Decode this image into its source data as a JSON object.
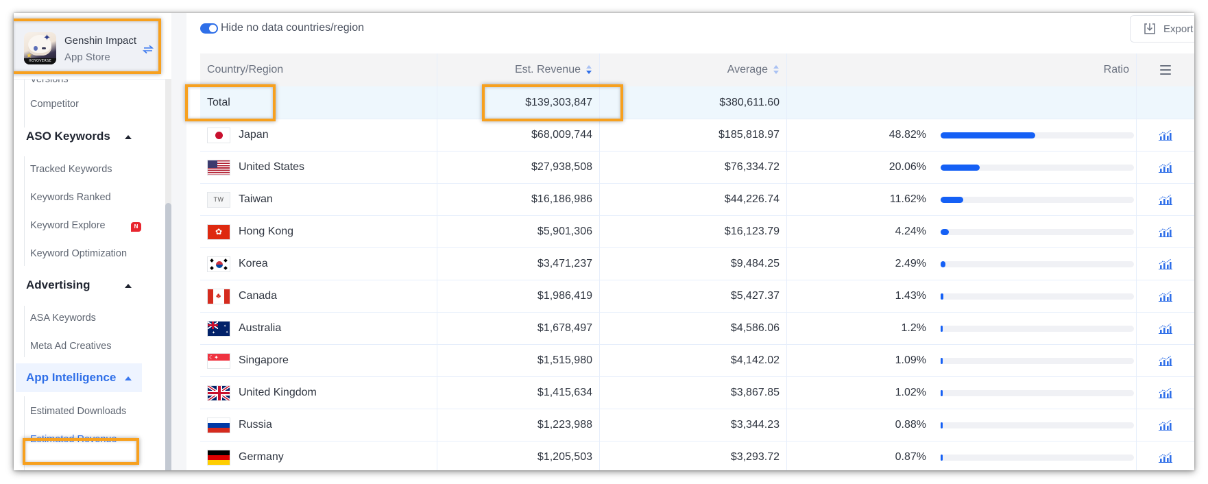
{
  "app": {
    "name": "Genshin Impact",
    "store": "App Store",
    "icon_brand": "HOYOVERSE",
    "switch_icon": "swap-arrows-icon"
  },
  "sidebar": {
    "items": [
      {
        "type": "item",
        "label": "Versions"
      },
      {
        "type": "item",
        "label": "Competitor"
      },
      {
        "type": "group",
        "label": "ASO Keywords",
        "expanded": true
      },
      {
        "type": "item",
        "label": "Tracked Keywords"
      },
      {
        "type": "item",
        "label": "Keywords Ranked"
      },
      {
        "type": "item",
        "label": "Keyword Explore",
        "badge": "N"
      },
      {
        "type": "item",
        "label": "Keyword Optimization"
      },
      {
        "type": "group",
        "label": "Advertising",
        "expanded": true
      },
      {
        "type": "item",
        "label": "ASA Keywords"
      },
      {
        "type": "item",
        "label": "Meta Ad Creatives"
      },
      {
        "type": "group",
        "label": "App Intelligence",
        "expanded": true,
        "active": true
      },
      {
        "type": "item",
        "label": "Estimated Downloads"
      },
      {
        "type": "item",
        "label": "Estimated Revenue",
        "active": true
      }
    ]
  },
  "toolbar": {
    "toggle_label": "Hide no data countries/region",
    "toggle_on": true,
    "export_label": "Export"
  },
  "table": {
    "headers": {
      "country": "Country/Region",
      "revenue": "Est. Revenue",
      "average": "Average",
      "ratio": "Ratio",
      "menu_icon": "column-menu-icon"
    },
    "total": {
      "label": "Total",
      "revenue": "$139,303,847",
      "average": "$380,611.60"
    },
    "rows": [
      {
        "country": "Japan",
        "flag": "jp",
        "revenue": "$68,009,744",
        "average": "$185,818.97",
        "ratio": "48.82%",
        "ratio_value": 48.82
      },
      {
        "country": "United States",
        "flag": "us",
        "revenue": "$27,938,508",
        "average": "$76,334.72",
        "ratio": "20.06%",
        "ratio_value": 20.06
      },
      {
        "country": "Taiwan",
        "flag": "tw",
        "flag_text": "TW",
        "revenue": "$16,186,986",
        "average": "$44,226.74",
        "ratio": "11.62%",
        "ratio_value": 11.62
      },
      {
        "country": "Hong Kong",
        "flag": "hk",
        "revenue": "$5,901,306",
        "average": "$16,123.79",
        "ratio": "4.24%",
        "ratio_value": 4.24
      },
      {
        "country": "Korea",
        "flag": "kr",
        "revenue": "$3,471,237",
        "average": "$9,484.25",
        "ratio": "2.49%",
        "ratio_value": 2.49
      },
      {
        "country": "Canada",
        "flag": "ca",
        "revenue": "$1,986,419",
        "average": "$5,427.37",
        "ratio": "1.43%",
        "ratio_value": 1.43
      },
      {
        "country": "Australia",
        "flag": "au",
        "revenue": "$1,678,497",
        "average": "$4,586.06",
        "ratio": "1.2%",
        "ratio_value": 1.2
      },
      {
        "country": "Singapore",
        "flag": "sg",
        "revenue": "$1,515,980",
        "average": "$4,142.02",
        "ratio": "1.09%",
        "ratio_value": 1.09
      },
      {
        "country": "United Kingdom",
        "flag": "gb",
        "revenue": "$1,415,634",
        "average": "$3,867.85",
        "ratio": "1.02%",
        "ratio_value": 1.02
      },
      {
        "country": "Russia",
        "flag": "ru",
        "revenue": "$1,223,988",
        "average": "$3,344.23",
        "ratio": "0.88%",
        "ratio_value": 0.88
      },
      {
        "country": "Germany",
        "flag": "de",
        "revenue": "$1,205,503",
        "average": "$3,293.72",
        "ratio": "0.87%",
        "ratio_value": 0.87
      }
    ]
  },
  "colors": {
    "accent": "#2f6fe8",
    "bar": "#1560f5",
    "highlight": "#f7a01e",
    "badge": "#e8262f"
  }
}
